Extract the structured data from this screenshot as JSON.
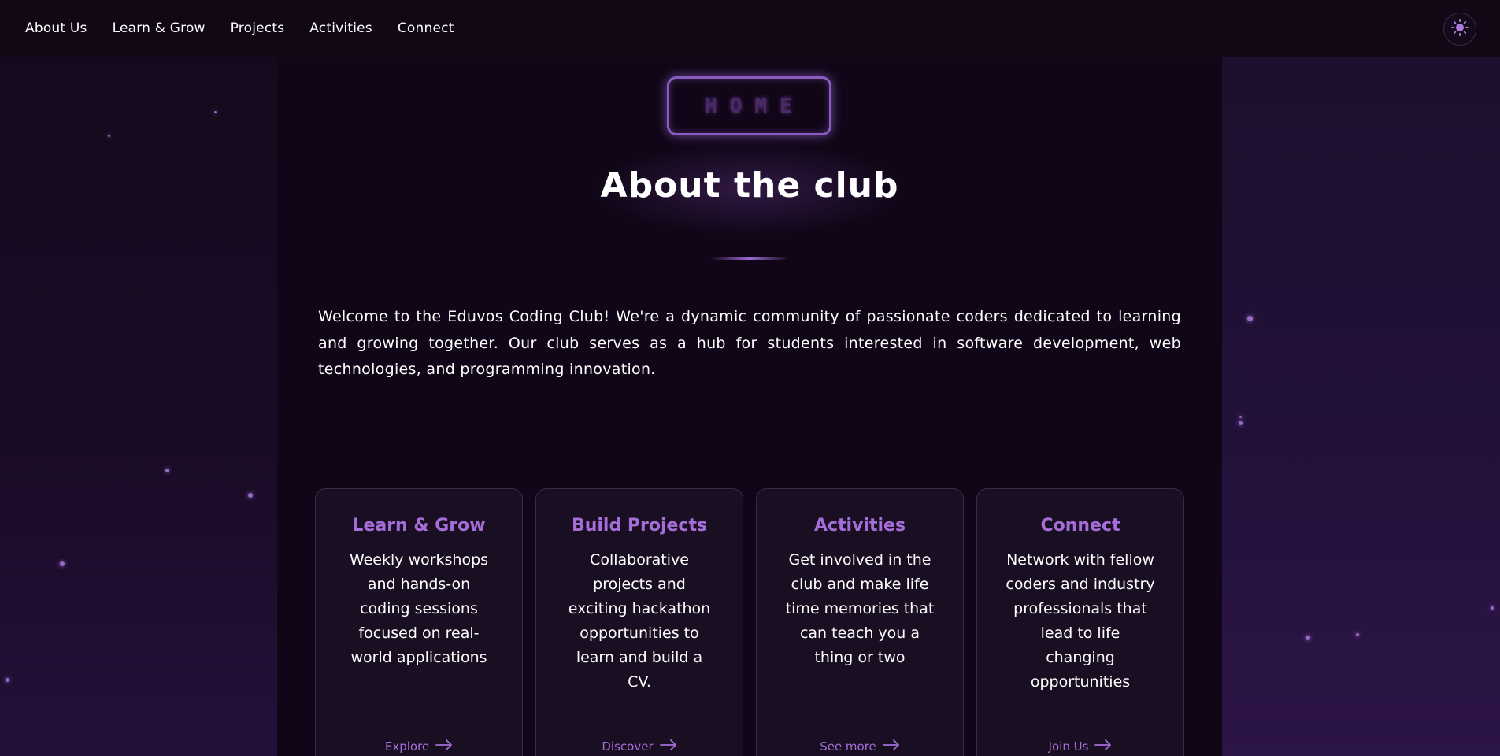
{
  "nav": {
    "items": [
      "About Us",
      "Learn & Grow",
      "Projects",
      "Activities",
      "Connect"
    ]
  },
  "theme_toggle": {
    "icon": "sun-icon"
  },
  "hero": {
    "badge": "HOME",
    "title": "About the club",
    "intro": "Welcome to the Eduvos Coding Club! We're a dynamic community of passionate coders dedicated to learning and growing together. Our club serves as a hub for students interested in software development, web technologies, and programming innovation."
  },
  "cards": [
    {
      "title": "Learn & Grow",
      "text": "Weekly workshops and hands-on coding sessions focused on real-world applications",
      "link": "Explore"
    },
    {
      "title": "Build Projects",
      "text": "Collaborative projects and exciting hackathon opportunities to learn and build a CV.",
      "link": "Discover"
    },
    {
      "title": "Activities",
      "text": "Get involved in the club and make life time memories that can teach you a thing or two",
      "link": "See more"
    },
    {
      "title": "Connect",
      "text": "Network with fellow coders and industry professionals that lead to life changing opportunities",
      "link": "Join Us"
    }
  ],
  "colors": {
    "background": "#0f0614",
    "accent": "#a46dd8",
    "card_bg": "#1a0f22"
  }
}
